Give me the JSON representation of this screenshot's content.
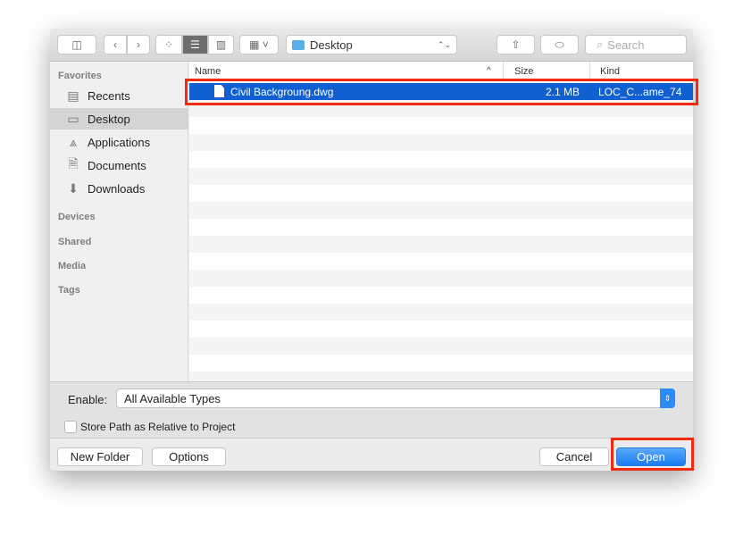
{
  "toolbar": {
    "location": "Desktop",
    "search_placeholder": "Search"
  },
  "sidebar": {
    "favorites": "Favorites",
    "items": [
      {
        "label": "Recents",
        "icon": "recents-icon"
      },
      {
        "label": "Desktop",
        "icon": "desktop-icon",
        "selected": true
      },
      {
        "label": "Applications",
        "icon": "applications-icon"
      },
      {
        "label": "Documents",
        "icon": "documents-icon"
      },
      {
        "label": "Downloads",
        "icon": "downloads-icon"
      }
    ],
    "sections": [
      "Devices",
      "Shared",
      "Media",
      "Tags"
    ]
  },
  "list": {
    "columns": [
      "Name",
      "Size",
      "Kind"
    ],
    "files": [
      {
        "name": "Civil Backgroung.dwg",
        "size": "2.1 MB",
        "kind": "LOC_C...ame_74",
        "selected": true
      }
    ]
  },
  "options": {
    "enable_label": "Enable:",
    "enable_value": "All Available Types",
    "store_path_label": "Store Path as Relative to Project",
    "store_path_checked": false
  },
  "buttons": {
    "new_folder": "New Folder",
    "options": "Options",
    "cancel": "Cancel",
    "open": "Open"
  },
  "colors": {
    "selection": "#1160d2",
    "highlight_box": "#f22a12",
    "primary_button": "#2a8cf7"
  }
}
